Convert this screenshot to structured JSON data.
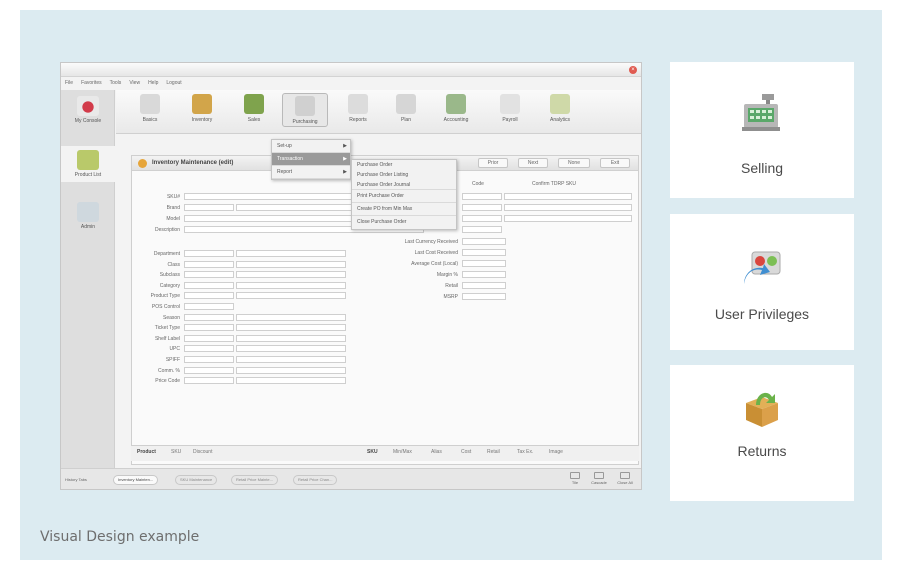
{
  "caption": "Visual Design example",
  "cards": [
    {
      "label": "Selling",
      "icon": "cash-register-icon"
    },
    {
      "label": "User Privileges",
      "icon": "user-privileges-icon"
    },
    {
      "label": "Returns",
      "icon": "returns-box-icon"
    }
  ],
  "app": {
    "menubar": [
      "File",
      "Favorites",
      "Tools",
      "View",
      "Help",
      "Logout"
    ],
    "left_nav": [
      "My Console",
      "Product List",
      "Admin"
    ],
    "toolbar": [
      "Basics",
      "Inventory",
      "Sales",
      "Purchasing",
      "Reports",
      "Plan",
      "Accounting",
      "Payroll",
      "Analytics"
    ],
    "purchasing_menu": [
      "Set-up",
      "Transaction",
      "Report"
    ],
    "transaction_menu": [
      "Purchase Order",
      "Purchase Order Listing",
      "Purchase Order Journal",
      "Print Purchase Order",
      "Create PO from Min Max",
      "Close Purchase Order"
    ],
    "form": {
      "title": "Inventory Maintenance (edit)",
      "buttons": [
        "Prior",
        "Next",
        "None",
        "Exit"
      ],
      "fields_left_top": [
        "SKU#",
        "Brand",
        "Model",
        "Description"
      ],
      "fields_left_bottom": [
        "Department",
        "Class",
        "Subclass",
        "Category",
        "Product Type",
        "POS Control",
        "Season",
        "Ticket Type",
        "Shelf Label",
        "UPC",
        "SPIFF",
        "Comm. %",
        "Price Code"
      ],
      "col_heads": [
        "Code",
        "Confirm TDRP SKU"
      ],
      "fields_right": [
        "Last Currency Received",
        "Last Cost Received",
        "Average Cost (Local)",
        "Margin %",
        "Retail",
        "MSRP"
      ],
      "tabs_left": [
        "Product",
        "SKU",
        "Discount"
      ],
      "tabs_right": [
        "SKU",
        "Min/Max",
        "Alias",
        "Cost",
        "Retail",
        "Tax Ex.",
        "Image"
      ]
    },
    "history_label": "History Tabs",
    "history_tabs": [
      "Inventory Mainten...",
      "SKU Maintenance",
      "Retail Price Mainte...",
      "Retail Price Chan..."
    ],
    "window_buttons": [
      "Tile",
      "Cascade",
      "Close All"
    ]
  }
}
